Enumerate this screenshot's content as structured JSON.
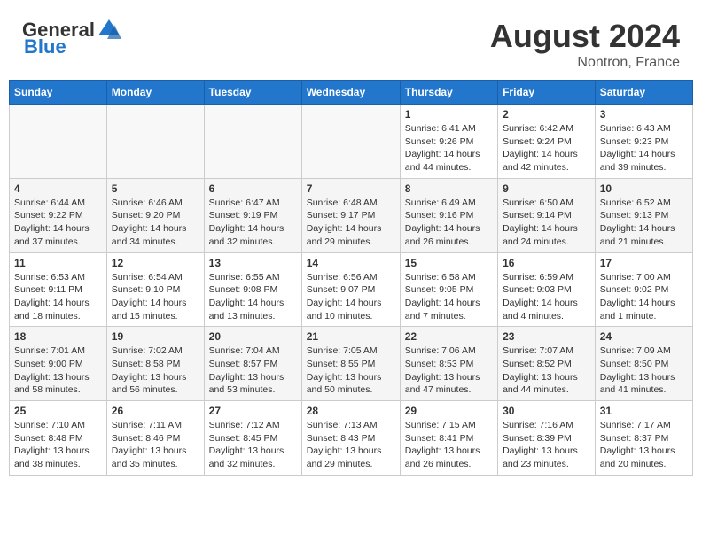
{
  "header": {
    "logo_general": "General",
    "logo_blue": "Blue",
    "month": "August 2024",
    "location": "Nontron, France"
  },
  "days_of_week": [
    "Sunday",
    "Monday",
    "Tuesday",
    "Wednesday",
    "Thursday",
    "Friday",
    "Saturday"
  ],
  "weeks": [
    [
      {
        "day": "",
        "info": ""
      },
      {
        "day": "",
        "info": ""
      },
      {
        "day": "",
        "info": ""
      },
      {
        "day": "",
        "info": ""
      },
      {
        "day": "1",
        "info": "Sunrise: 6:41 AM\nSunset: 9:26 PM\nDaylight: 14 hours\nand 44 minutes."
      },
      {
        "day": "2",
        "info": "Sunrise: 6:42 AM\nSunset: 9:24 PM\nDaylight: 14 hours\nand 42 minutes."
      },
      {
        "day": "3",
        "info": "Sunrise: 6:43 AM\nSunset: 9:23 PM\nDaylight: 14 hours\nand 39 minutes."
      }
    ],
    [
      {
        "day": "4",
        "info": "Sunrise: 6:44 AM\nSunset: 9:22 PM\nDaylight: 14 hours\nand 37 minutes."
      },
      {
        "day": "5",
        "info": "Sunrise: 6:46 AM\nSunset: 9:20 PM\nDaylight: 14 hours\nand 34 minutes."
      },
      {
        "day": "6",
        "info": "Sunrise: 6:47 AM\nSunset: 9:19 PM\nDaylight: 14 hours\nand 32 minutes."
      },
      {
        "day": "7",
        "info": "Sunrise: 6:48 AM\nSunset: 9:17 PM\nDaylight: 14 hours\nand 29 minutes."
      },
      {
        "day": "8",
        "info": "Sunrise: 6:49 AM\nSunset: 9:16 PM\nDaylight: 14 hours\nand 26 minutes."
      },
      {
        "day": "9",
        "info": "Sunrise: 6:50 AM\nSunset: 9:14 PM\nDaylight: 14 hours\nand 24 minutes."
      },
      {
        "day": "10",
        "info": "Sunrise: 6:52 AM\nSunset: 9:13 PM\nDaylight: 14 hours\nand 21 minutes."
      }
    ],
    [
      {
        "day": "11",
        "info": "Sunrise: 6:53 AM\nSunset: 9:11 PM\nDaylight: 14 hours\nand 18 minutes."
      },
      {
        "day": "12",
        "info": "Sunrise: 6:54 AM\nSunset: 9:10 PM\nDaylight: 14 hours\nand 15 minutes."
      },
      {
        "day": "13",
        "info": "Sunrise: 6:55 AM\nSunset: 9:08 PM\nDaylight: 14 hours\nand 13 minutes."
      },
      {
        "day": "14",
        "info": "Sunrise: 6:56 AM\nSunset: 9:07 PM\nDaylight: 14 hours\nand 10 minutes."
      },
      {
        "day": "15",
        "info": "Sunrise: 6:58 AM\nSunset: 9:05 PM\nDaylight: 14 hours\nand 7 minutes."
      },
      {
        "day": "16",
        "info": "Sunrise: 6:59 AM\nSunset: 9:03 PM\nDaylight: 14 hours\nand 4 minutes."
      },
      {
        "day": "17",
        "info": "Sunrise: 7:00 AM\nSunset: 9:02 PM\nDaylight: 14 hours\nand 1 minute."
      }
    ],
    [
      {
        "day": "18",
        "info": "Sunrise: 7:01 AM\nSunset: 9:00 PM\nDaylight: 13 hours\nand 58 minutes."
      },
      {
        "day": "19",
        "info": "Sunrise: 7:02 AM\nSunset: 8:58 PM\nDaylight: 13 hours\nand 56 minutes."
      },
      {
        "day": "20",
        "info": "Sunrise: 7:04 AM\nSunset: 8:57 PM\nDaylight: 13 hours\nand 53 minutes."
      },
      {
        "day": "21",
        "info": "Sunrise: 7:05 AM\nSunset: 8:55 PM\nDaylight: 13 hours\nand 50 minutes."
      },
      {
        "day": "22",
        "info": "Sunrise: 7:06 AM\nSunset: 8:53 PM\nDaylight: 13 hours\nand 47 minutes."
      },
      {
        "day": "23",
        "info": "Sunrise: 7:07 AM\nSunset: 8:52 PM\nDaylight: 13 hours\nand 44 minutes."
      },
      {
        "day": "24",
        "info": "Sunrise: 7:09 AM\nSunset: 8:50 PM\nDaylight: 13 hours\nand 41 minutes."
      }
    ],
    [
      {
        "day": "25",
        "info": "Sunrise: 7:10 AM\nSunset: 8:48 PM\nDaylight: 13 hours\nand 38 minutes."
      },
      {
        "day": "26",
        "info": "Sunrise: 7:11 AM\nSunset: 8:46 PM\nDaylight: 13 hours\nand 35 minutes."
      },
      {
        "day": "27",
        "info": "Sunrise: 7:12 AM\nSunset: 8:45 PM\nDaylight: 13 hours\nand 32 minutes."
      },
      {
        "day": "28",
        "info": "Sunrise: 7:13 AM\nSunset: 8:43 PM\nDaylight: 13 hours\nand 29 minutes."
      },
      {
        "day": "29",
        "info": "Sunrise: 7:15 AM\nSunset: 8:41 PM\nDaylight: 13 hours\nand 26 minutes."
      },
      {
        "day": "30",
        "info": "Sunrise: 7:16 AM\nSunset: 8:39 PM\nDaylight: 13 hours\nand 23 minutes."
      },
      {
        "day": "31",
        "info": "Sunrise: 7:17 AM\nSunset: 8:37 PM\nDaylight: 13 hours\nand 20 minutes."
      }
    ]
  ]
}
